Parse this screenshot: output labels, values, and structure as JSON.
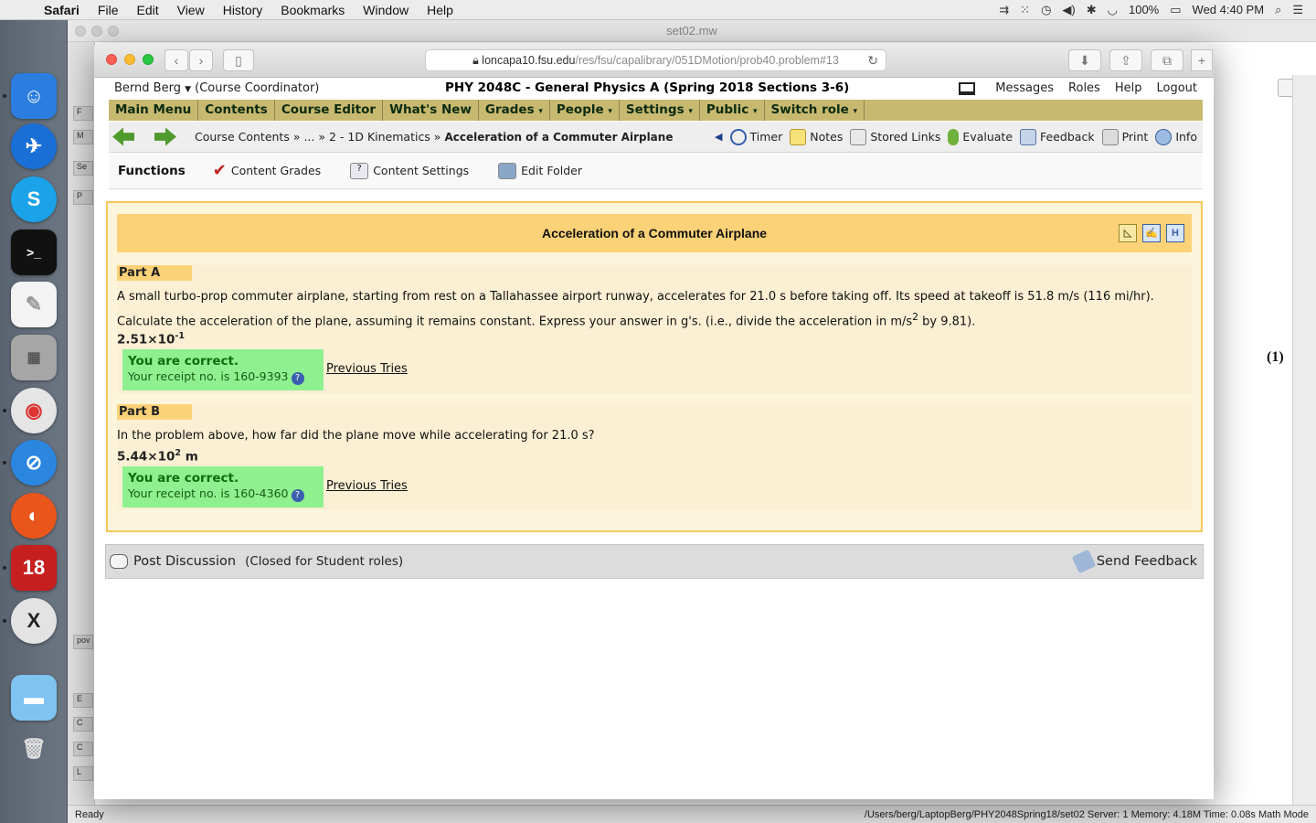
{
  "menubar": {
    "app": "Safari",
    "items": [
      "File",
      "Edit",
      "View",
      "History",
      "Bookmarks",
      "Window",
      "Help"
    ],
    "battery": "100%",
    "clock": "Wed 4:40 PM"
  },
  "bg_window": {
    "title": "set02.mw",
    "equation_number": "(1)",
    "sidepane_labels": [
      "F",
      "M",
      "Se",
      "P",
      "pov",
      "E",
      "C",
      "C",
      "L"
    ],
    "status_left": "Ready",
    "status_right": "/Users/berg/LaptopBerg/PHY2048Spring18/set02   Server: 1   Memory: 4.18M   Time: 0.08s   Math Mode"
  },
  "safari": {
    "url_host": "loncapa10.fsu.edu",
    "url_path": "/res/fsu/capalibrary/051DMotion/prob40.problem#13"
  },
  "lc": {
    "user": "Bernd Berg",
    "role": "(Course Coordinator)",
    "course": "PHY 2048C - General Physics A (Spring 2018 Sections 3-6)",
    "top_links": [
      "Messages",
      "Roles",
      "Help",
      "Logout"
    ],
    "nav": [
      {
        "label": "Main Menu",
        "caret": ""
      },
      {
        "label": "Contents",
        "caret": ""
      },
      {
        "label": "Course Editor",
        "caret": ""
      },
      {
        "label": "What's New",
        "caret": ""
      },
      {
        "label": "Grades",
        "caret": "▾"
      },
      {
        "label": "People",
        "caret": "▾"
      },
      {
        "label": "Settings",
        "caret": "▾"
      },
      {
        "label": "Public",
        "caret": "▾"
      },
      {
        "label": "Switch role",
        "caret": "▾"
      }
    ],
    "breadcrumb": {
      "part1": "Course Contents »",
      "part2": "... »",
      "part3": "2 - 1D Kinematics »",
      "current": "Acceleration of a Commuter Airplane"
    },
    "tools": [
      "Timer",
      "Notes",
      "Stored Links",
      "Evaluate",
      "Feedback",
      "Print",
      "Info"
    ],
    "functions": {
      "title": "Functions",
      "items": [
        "Content Grades",
        "Content Settings",
        "Edit Folder"
      ]
    }
  },
  "problem": {
    "title": "Acceleration of a Commuter Airplane",
    "partA": {
      "label": "Part A",
      "text1": "A small turbo-prop commuter airplane, starting from rest on a Tallahassee airport runway, accelerates for 21.0 s before taking off. Its speed at takeoff is 51.8 m/s (116 mi/hr).",
      "text2a": "Calculate the acceleration of the plane, assuming it remains constant. Express your answer in g's. (i.e., divide the acceleration in m/s",
      "text2sup": "2",
      "text2b": " by 9.81).",
      "answer_base": "2.51×10",
      "answer_exp": "-1",
      "answer_unit": "",
      "status": "You are correct.",
      "receipt": "Your receipt no. is 160-9393",
      "prev": "Previous Tries"
    },
    "partB": {
      "label": "Part B",
      "text1": "In the problem above, how far did the plane move while accelerating for 21.0 s?",
      "answer_base": "5.44×10",
      "answer_exp": "2",
      "answer_unit": " m",
      "status": "You are correct.",
      "receipt": "Your receipt no. is 160-4360",
      "prev": "Previous Tries"
    }
  },
  "discussion": {
    "post": "Post Discussion",
    "closed": "(Closed for Student roles)",
    "send": "Send Feedback"
  },
  "colors": {
    "nav_bg": "#c8b970",
    "problem_border": "#f6c85a",
    "header_bg": "#fbd278",
    "correct_bg": "#8ff08f"
  }
}
